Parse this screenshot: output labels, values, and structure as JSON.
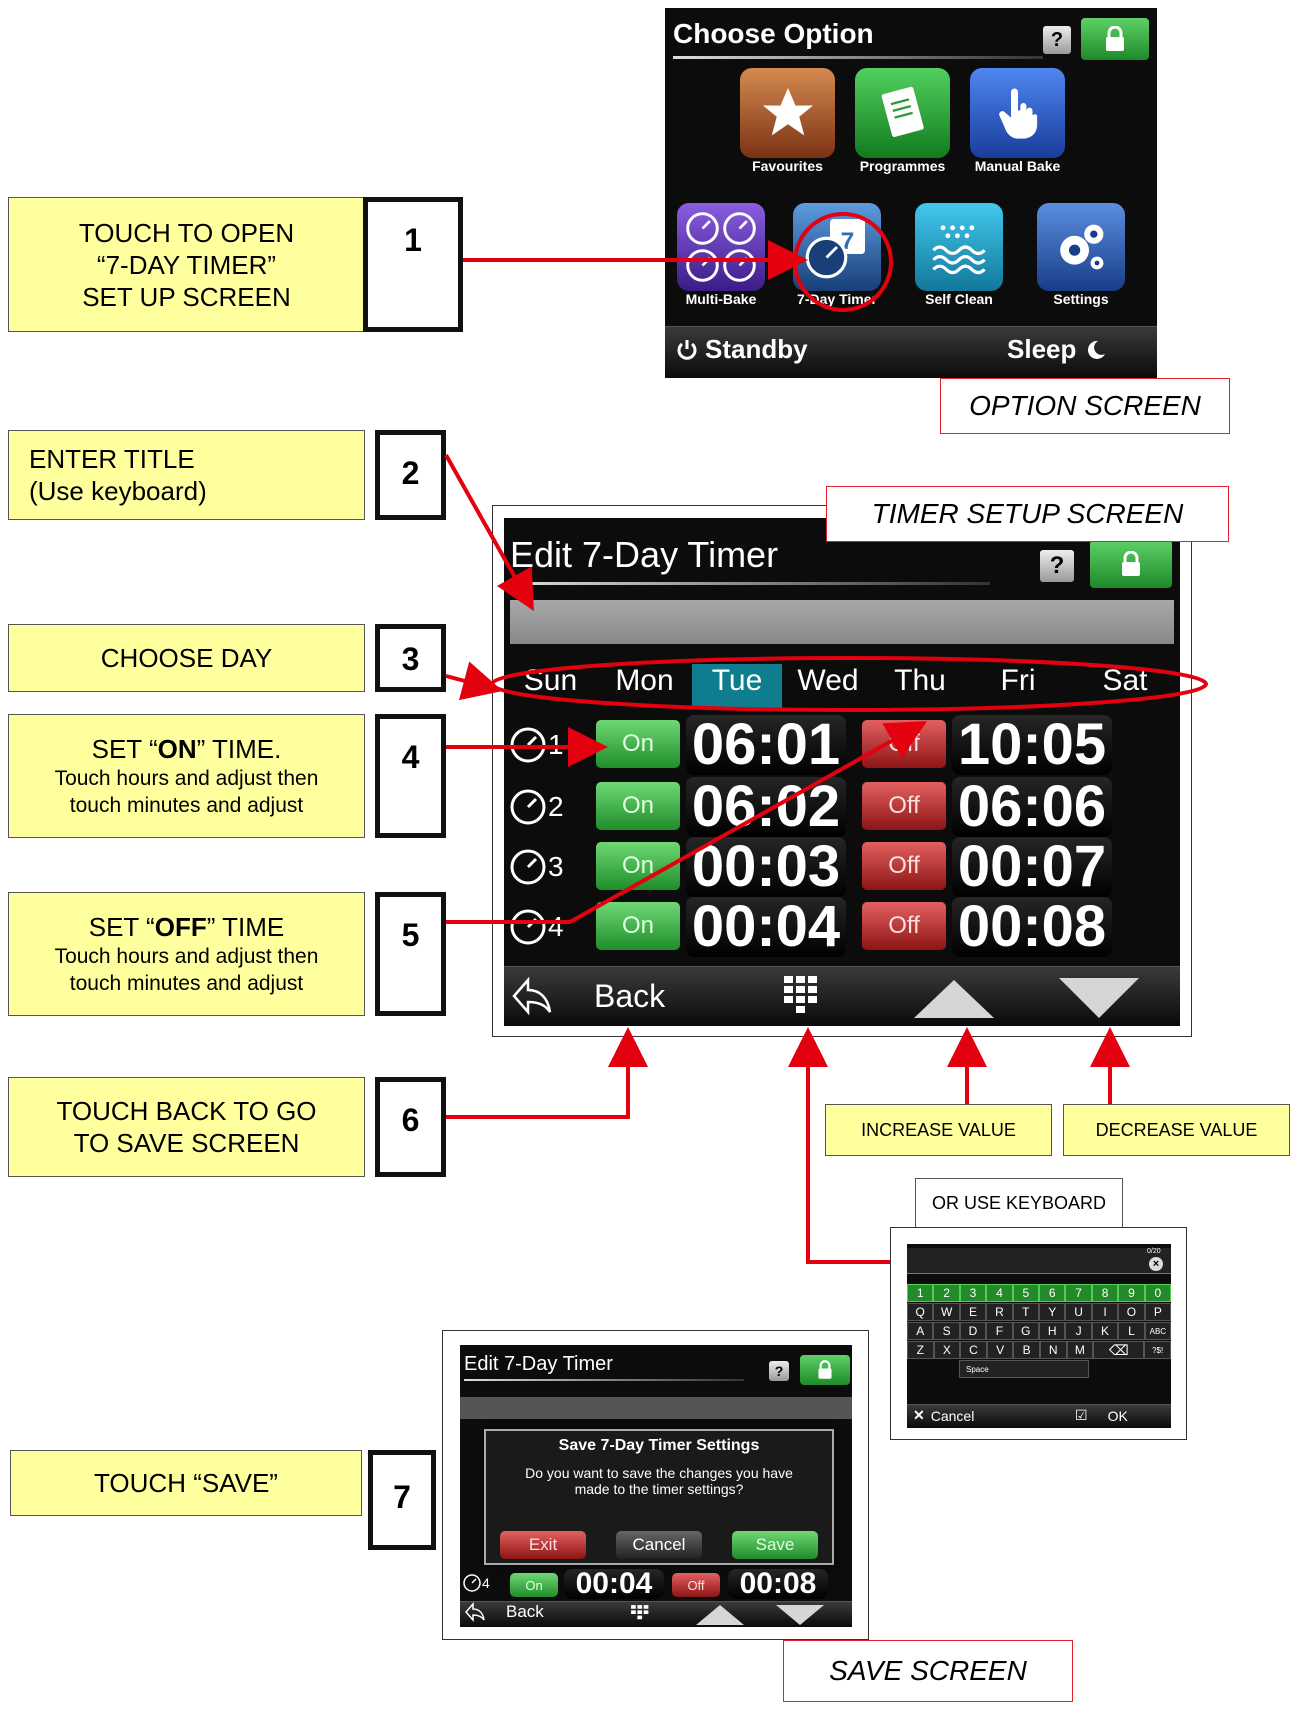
{
  "annotations": {
    "step1": {
      "num": "1",
      "lines": [
        "TOUCH TO OPEN",
        "“7-DAY TIMER”",
        "SET UP SCREEN"
      ]
    },
    "step2": {
      "num": "2",
      "line1": "ENTER TITLE",
      "line2": "(Use keyboard)"
    },
    "step3": {
      "num": "3",
      "text": "CHOOSE DAY"
    },
    "step4": {
      "num": "4",
      "pre": "SET “",
      "bold": "ON",
      "post": "” TIME.",
      "sub1": "Touch hours and adjust then",
      "sub2": "touch minutes and adjust"
    },
    "step5": {
      "num": "5",
      "pre": "SET “",
      "bold": "OFF",
      "post": "” TIME",
      "sub1": "Touch hours and adjust then",
      "sub2": "touch minutes and adjust"
    },
    "step6": {
      "num": "6",
      "line1": "TOUCH BACK TO GO",
      "line2": "TO SAVE SCREEN"
    },
    "step7": {
      "num": "7",
      "text": "TOUCH “SAVE”"
    },
    "increase": "INCREASE VALUE",
    "decrease": "DECREASE VALUE",
    "keyboard_note": "OR USE KEYBOARD",
    "label_option": "OPTION SCREEN",
    "label_timer": "TIMER SETUP SCREEN",
    "label_save": "SAVE SCREEN"
  },
  "option_screen": {
    "title": "Choose Option",
    "help": "?",
    "tiles": [
      {
        "label": "Favourites",
        "icon": "star-icon",
        "color": "#b05a2a"
      },
      {
        "label": "Programmes",
        "icon": "document-icon",
        "color": "#2c9a38"
      },
      {
        "label": "Manual Bake",
        "icon": "hand-pointer-icon",
        "color": "#2a5ed0"
      },
      {
        "label": "Multi-Bake",
        "icon": "multi-clock-icon",
        "color": "#6a3cc0"
      },
      {
        "label": "7-Day Timer",
        "icon": "calendar-clock-icon",
        "color": "#2f6fb0"
      },
      {
        "label": "Self Clean",
        "icon": "waves-icon",
        "color": "#1fa0c8"
      },
      {
        "label": "Settings",
        "icon": "gears-icon",
        "color": "#2f62b8"
      }
    ],
    "standby": "Standby",
    "sleep": "Sleep"
  },
  "timer_screen": {
    "title": "Edit 7-Day Timer",
    "help": "?",
    "days": [
      "Sun",
      "Mon",
      "Tue",
      "Wed",
      "Thu",
      "Fri",
      "Sat"
    ],
    "selected_day": "Tue",
    "rows": [
      {
        "num": "1",
        "on_label": "On",
        "on_time": "06:01",
        "off_label": "Off",
        "off_time": "10:05"
      },
      {
        "num": "2",
        "on_label": "On",
        "on_time": "06:02",
        "off_label": "Off",
        "off_time": "06:06"
      },
      {
        "num": "3",
        "on_label": "On",
        "on_time": "00:03",
        "off_label": "Off",
        "off_time": "00:07"
      },
      {
        "num": "4",
        "on_label": "On",
        "on_time": "00:04",
        "off_label": "Off",
        "off_time": "00:08"
      }
    ],
    "back": "Back"
  },
  "keyboard": {
    "counter": "0/20",
    "numbers": [
      "1",
      "2",
      "3",
      "4",
      "5",
      "6",
      "7",
      "8",
      "9",
      "0"
    ],
    "row1": [
      "Q",
      "W",
      "E",
      "R",
      "T",
      "Y",
      "U",
      "I",
      "O",
      "P"
    ],
    "row2": [
      "A",
      "S",
      "D",
      "F",
      "G",
      "H",
      "J",
      "K",
      "L"
    ],
    "row2_extra": "ABC",
    "row3": [
      "Z",
      "X",
      "C",
      "V",
      "B",
      "N",
      "M"
    ],
    "row3_extra": "?$!",
    "space": "Space",
    "cancel": "Cancel",
    "ok": "OK"
  },
  "save_screen": {
    "title": "Edit 7-Day Timer",
    "help": "?",
    "dialog_title": "Save 7-Day Timer Settings",
    "dialog_line1": "Do you want to save the changes you have",
    "dialog_line2": "made to the timer settings?",
    "exit": "Exit",
    "cancel": "Cancel",
    "save": "Save",
    "row": {
      "num": "4",
      "on_label": "On",
      "on_time": "00:04",
      "off_label": "Off",
      "off_time": "00:08"
    },
    "back": "Back"
  }
}
